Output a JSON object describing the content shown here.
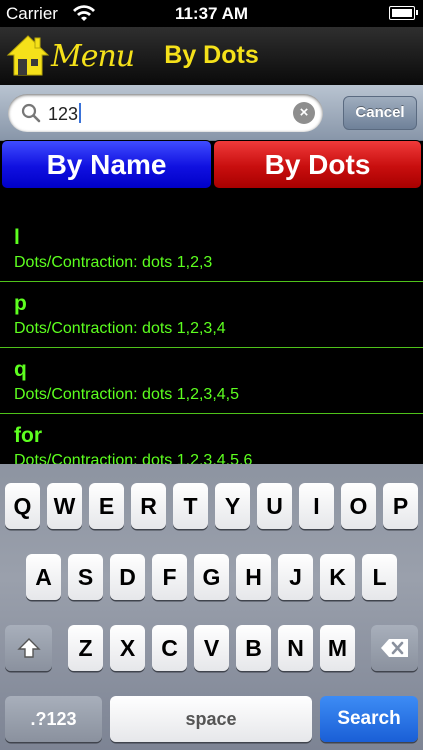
{
  "status": {
    "carrier": "Carrier",
    "time": "11:37 AM"
  },
  "nav": {
    "menu_label": "Menu",
    "title": "By Dots"
  },
  "search": {
    "value": "123",
    "cancel_label": "Cancel",
    "clear_icon": "×"
  },
  "segments": {
    "by_name": "By Name",
    "by_dots": "By Dots"
  },
  "results": [
    {
      "word": "l",
      "desc": "Dots/Contraction: dots 1,2,3"
    },
    {
      "word": "p",
      "desc": "Dots/Contraction: dots 1,2,3,4"
    },
    {
      "word": "q",
      "desc": "Dots/Contraction: dots 1,2,3,4,5"
    },
    {
      "word": "for",
      "desc": "Dots/Contraction: dots 1,2,3,4,5,6"
    }
  ],
  "keyboard": {
    "row1": [
      "Q",
      "W",
      "E",
      "R",
      "T",
      "Y",
      "U",
      "I",
      "O",
      "P"
    ],
    "row2": [
      "A",
      "S",
      "D",
      "F",
      "G",
      "H",
      "J",
      "K",
      "L"
    ],
    "row3": [
      "Z",
      "X",
      "C",
      "V",
      "B",
      "N",
      "M"
    ],
    "numbers_label": ".?123",
    "space_label": "space",
    "search_label": "Search"
  },
  "colors": {
    "accent_yellow": "#f5e11a",
    "result_green": "#5dff1f",
    "by_name_blue": "#1010e0",
    "by_dots_red": "#c80e0e"
  }
}
